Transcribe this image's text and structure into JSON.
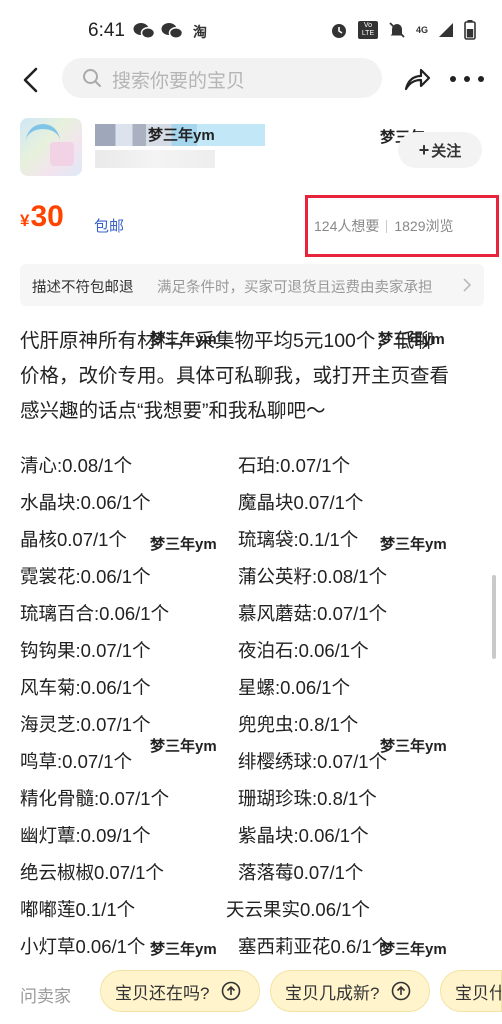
{
  "status_bar": {
    "time": "6:41",
    "left_icons": [
      "wechat-icon",
      "wechat-icon",
      "taobao-icon"
    ],
    "taobao_text": "淘",
    "right_icons": [
      "alarm-icon",
      "volte-icon",
      "mute-icon",
      "data-4g-icon",
      "signal-icon",
      "battery-icon"
    ],
    "volte_text": "Vo LTE",
    "net_text": "4G"
  },
  "header": {
    "search_placeholder": "搜索你要的宝贝"
  },
  "seller": {
    "watermark": "梦三年ym",
    "follow_label": "关注",
    "follow_plus": "+"
  },
  "price": {
    "symbol": "¥",
    "value": "30",
    "shipping": "包邮",
    "wants": "124人想要",
    "views": "1829浏览",
    "highlight_color": "#e8243c"
  },
  "guarantee": {
    "title": "描述不符包邮退",
    "desc": "满足条件时，买家可退货且运费由卖家承担"
  },
  "description": {
    "line1": "代肝原神所有材料，采集物平均5元100个，低聊",
    "line2": "价格，改价专用。具体可私聊我，或打开主页查看",
    "line3": "感兴趣的话点“我想要”和我私聊吧～"
  },
  "items": [
    "清心:0.08/1个",
    "石珀:0.07/1个",
    "水晶块:0.06/1个",
    "魔晶块0.07/1个",
    "晶核0.07/1个",
    "琉璃袋:0.1/1个",
    "霓裳花:0.06/1个",
    "蒲公英籽:0.08/1个",
    "琉璃百合:0.06/1个",
    "慕风蘑菇:0.07/1个",
    "钩钩果:0.07/1个",
    "夜泊石:0.06/1个",
    "风车菊:0.06/1个",
    "星螺:0.06/1个",
    "海灵芝:0.07/1个",
    "兜兜虫:0.8/1个",
    "鸣草:0.07/1个",
    "绯樱绣球:0.07/1个",
    "精化骨髓:0.07/1个",
    "珊瑚珍珠:0.8/1个",
    "幽灯蕈:0.09/1个",
    "紫晶块:0.06/1个",
    "绝云椒椒0.07/1个",
    "落落莓0.07/1个",
    "嘟嘟莲0.1/1个",
    "天云果实0.06/1个",
    "小灯草0.06/1个",
    "塞西莉亚花0.6/1个"
  ],
  "bottom_bar": {
    "ask_label": "问卖家",
    "chips": [
      "宝贝还在吗?",
      "宝贝几成新?",
      "宝贝什么"
    ]
  },
  "colors": {
    "accent": "#ff4400",
    "link": "#3a63c8",
    "chip_bg": "#fff4cc"
  }
}
